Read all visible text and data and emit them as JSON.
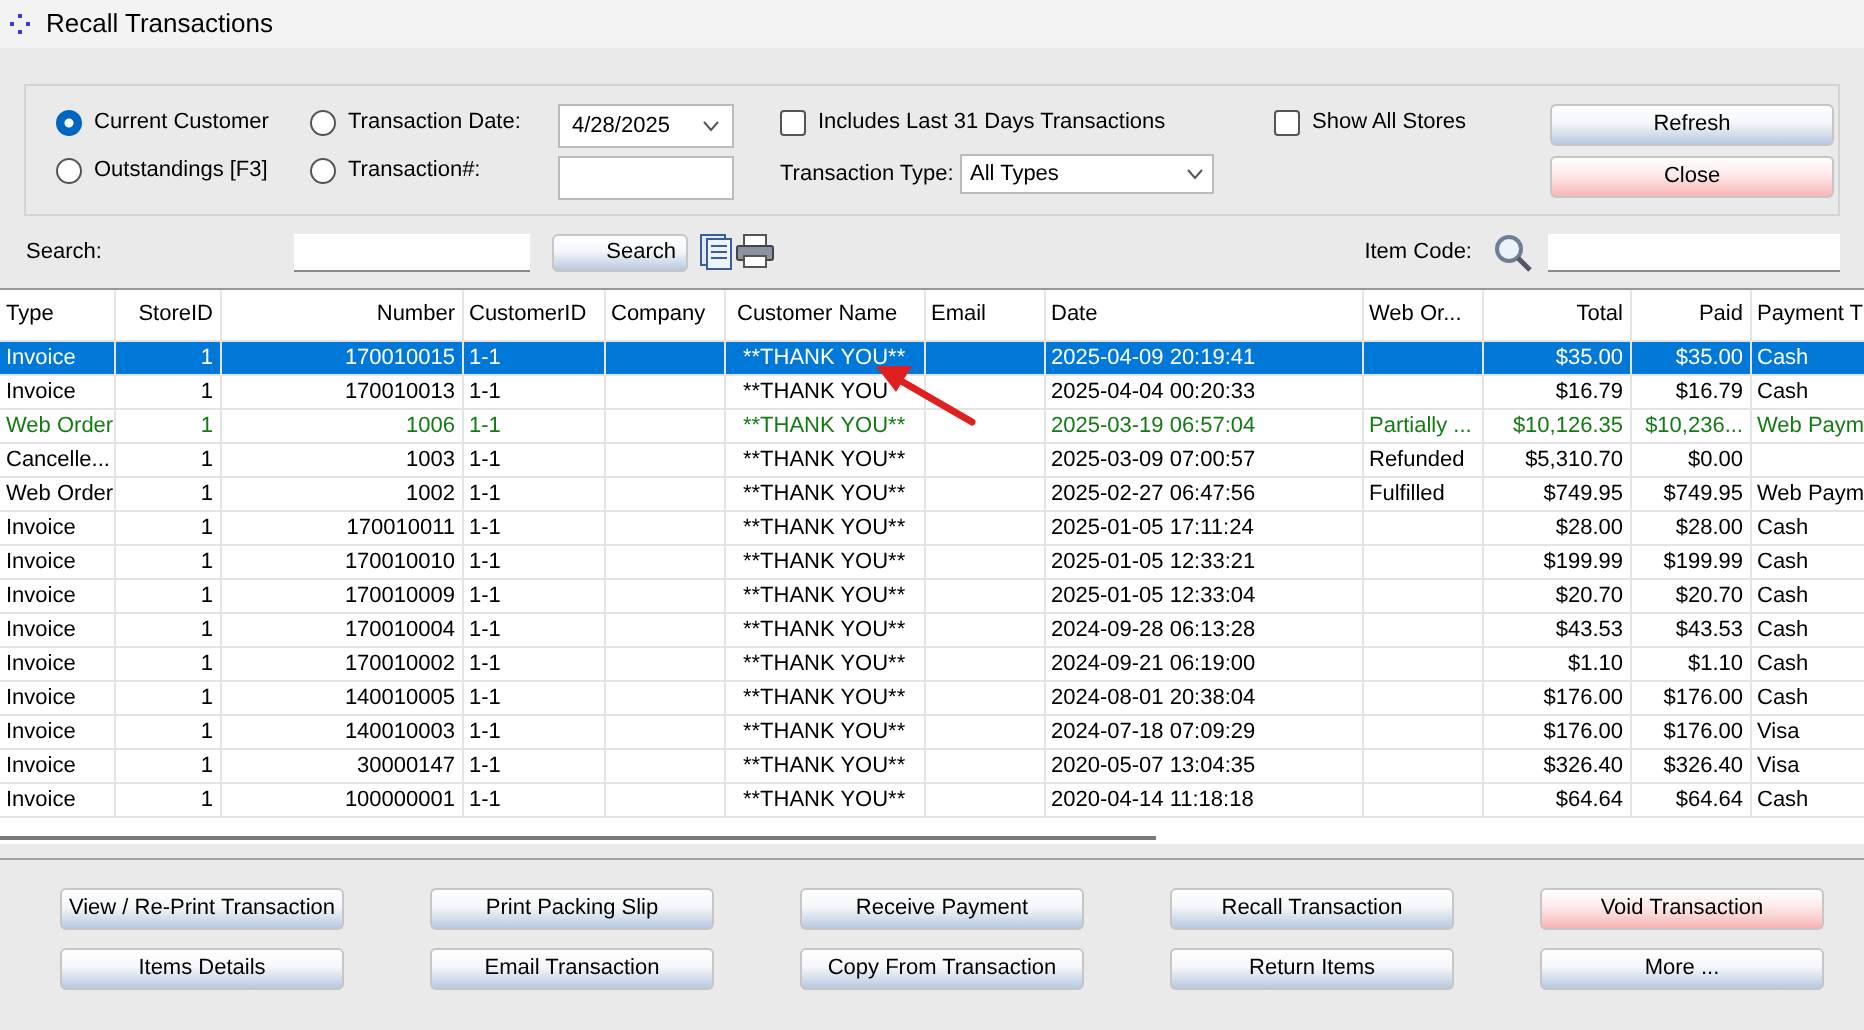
{
  "window": {
    "title": "Recall Transactions"
  },
  "filters": {
    "radios": [
      {
        "label": "Current Customer",
        "selected": true
      },
      {
        "label": "Outstandings [F3]",
        "selected": false
      },
      {
        "label": "Transaction Date:",
        "selected": false
      },
      {
        "label": "Transaction#:",
        "selected": false
      }
    ],
    "date_value": "4/28/2025",
    "checkboxes": [
      {
        "label": "Includes Last 31 Days Transactions",
        "checked": false
      },
      {
        "label": "Show All Stores",
        "checked": false
      }
    ],
    "type_label": "Transaction Type:",
    "type_value": "All Types"
  },
  "top_buttons": [
    {
      "label": "Refresh",
      "kind": "normal"
    },
    {
      "label": "Close",
      "kind": "alert"
    }
  ],
  "search": {
    "label": "Search:",
    "button": "Search",
    "item_code_label": "Item Code:"
  },
  "table": {
    "columns": [
      "Type",
      "StoreID",
      "Number",
      "CustomerID",
      "Company",
      "Customer Name",
      "Email",
      "Date",
      "Web Or...",
      "Total",
      "Paid",
      "Payment T"
    ],
    "rows": [
      {
        "selected": true,
        "color": "#ffffff",
        "cells": [
          "Invoice",
          "1",
          "170010015",
          "1-1",
          "",
          "**THANK YOU**",
          "",
          "2025-04-09 20:19:41",
          "",
          "$35.00",
          "$35.00",
          "Cash"
        ]
      },
      {
        "selected": false,
        "color": "#000000",
        "cells": [
          "Invoice",
          "1",
          "170010013",
          "1-1",
          "",
          "**THANK YOU",
          "",
          "2025-04-04 00:20:33",
          "",
          "$16.79",
          "$16.79",
          "Cash"
        ]
      },
      {
        "selected": false,
        "color": "#157a15",
        "cells": [
          "Web Order",
          "1",
          "1006",
          "1-1",
          "",
          "**THANK YOU**",
          "",
          "2025-03-19 06:57:04",
          "Partially ...",
          "$10,126.35",
          "$10,236...",
          "Web Paym"
        ]
      },
      {
        "selected": false,
        "color": "#000000",
        "cells": [
          "Cancelle...",
          "1",
          "1003",
          "1-1",
          "",
          "**THANK YOU**",
          "",
          "2025-03-09 07:00:57",
          "Refunded",
          "$5,310.70",
          "$0.00",
          ""
        ]
      },
      {
        "selected": false,
        "color": "#000000",
        "cells": [
          "Web Order",
          "1",
          "1002",
          "1-1",
          "",
          "**THANK YOU**",
          "",
          "2025-02-27 06:47:56",
          "Fulfilled",
          "$749.95",
          "$749.95",
          "Web Paym"
        ]
      },
      {
        "selected": false,
        "color": "#000000",
        "cells": [
          "Invoice",
          "1",
          "170010011",
          "1-1",
          "",
          "**THANK YOU**",
          "",
          "2025-01-05 17:11:24",
          "",
          "$28.00",
          "$28.00",
          "Cash"
        ]
      },
      {
        "selected": false,
        "color": "#000000",
        "cells": [
          "Invoice",
          "1",
          "170010010",
          "1-1",
          "",
          "**THANK YOU**",
          "",
          "2025-01-05 12:33:21",
          "",
          "$199.99",
          "$199.99",
          "Cash"
        ]
      },
      {
        "selected": false,
        "color": "#000000",
        "cells": [
          "Invoice",
          "1",
          "170010009",
          "1-1",
          "",
          "**THANK YOU**",
          "",
          "2025-01-05 12:33:04",
          "",
          "$20.70",
          "$20.70",
          "Cash"
        ]
      },
      {
        "selected": false,
        "color": "#000000",
        "cells": [
          "Invoice",
          "1",
          "170010004",
          "1-1",
          "",
          "**THANK YOU**",
          "",
          "2024-09-28 06:13:28",
          "",
          "$43.53",
          "$43.53",
          "Cash"
        ]
      },
      {
        "selected": false,
        "color": "#000000",
        "cells": [
          "Invoice",
          "1",
          "170010002",
          "1-1",
          "",
          "**THANK YOU**",
          "",
          "2024-09-21 06:19:00",
          "",
          "$1.10",
          "$1.10",
          "Cash"
        ]
      },
      {
        "selected": false,
        "color": "#000000",
        "cells": [
          "Invoice",
          "1",
          "140010005",
          "1-1",
          "",
          "**THANK YOU**",
          "",
          "2024-08-01 20:38:04",
          "",
          "$176.00",
          "$176.00",
          "Cash"
        ]
      },
      {
        "selected": false,
        "color": "#000000",
        "cells": [
          "Invoice",
          "1",
          "140010003",
          "1-1",
          "",
          "**THANK YOU**",
          "",
          "2024-07-18 07:09:29",
          "",
          "$176.00",
          "$176.00",
          "Visa"
        ]
      },
      {
        "selected": false,
        "color": "#000000",
        "cells": [
          "Invoice",
          "1",
          "30000147",
          "1-1",
          "",
          "**THANK YOU**",
          "",
          "2020-05-07 13:04:35",
          "",
          "$326.40",
          "$326.40",
          "Visa"
        ]
      },
      {
        "selected": false,
        "color": "#000000",
        "cells": [
          "Invoice",
          "1",
          "100000001",
          "1-1",
          "",
          "**THANK YOU**",
          "",
          "2020-04-14 11:18:18",
          "",
          "$64.64",
          "$64.64",
          "Cash"
        ]
      }
    ]
  },
  "bottom_buttons": [
    {
      "label": "View / Re-Print Transaction",
      "kind": "normal"
    },
    {
      "label": "Print Packing Slip",
      "kind": "normal"
    },
    {
      "label": "Receive Payment",
      "kind": "normal"
    },
    {
      "label": "Recall Transaction",
      "kind": "normal"
    },
    {
      "label": "Void Transaction",
      "kind": "alert"
    },
    {
      "label": "Items Details",
      "kind": "normal"
    },
    {
      "label": "Email Transaction",
      "kind": "normal"
    },
    {
      "label": "Copy From Transaction",
      "kind": "normal"
    },
    {
      "label": "Return Items",
      "kind": "normal"
    },
    {
      "label": "More ...",
      "kind": "normal"
    }
  ]
}
